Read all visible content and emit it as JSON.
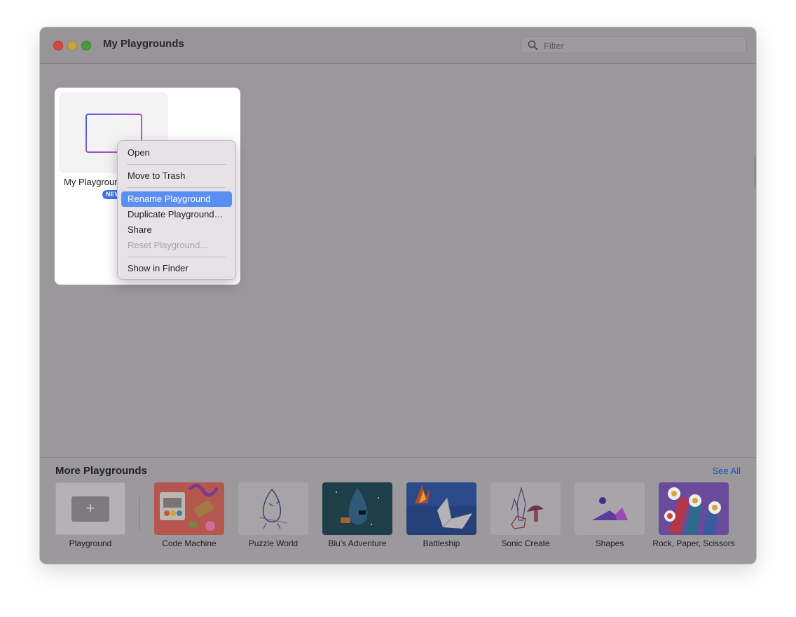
{
  "window": {
    "title": "My Playgrounds"
  },
  "filter": {
    "placeholder": "Filter"
  },
  "playground_tile": {
    "name": "My Playground",
    "badge": "NEW"
  },
  "context_menu": {
    "items": [
      {
        "label": "Open"
      },
      {
        "label": "Move to Trash"
      },
      {
        "label": "Rename Playground",
        "highlighted": true
      },
      {
        "label": "Duplicate Playground…"
      },
      {
        "label": "Share"
      },
      {
        "label": "Reset Playground…",
        "disabled": true
      },
      {
        "label": "Show in Finder"
      }
    ]
  },
  "more_playgrounds": {
    "title": "More Playgrounds",
    "see_all": "See All",
    "cards": [
      {
        "label": "Playground",
        "icon": "plus-icon"
      },
      {
        "label": "Code Machine"
      },
      {
        "label": "Puzzle World"
      },
      {
        "label": "Blu's Adventure"
      },
      {
        "label": "Battleship"
      },
      {
        "label": "Sonic Create"
      },
      {
        "label": "Shapes"
      },
      {
        "label": "Rock, Paper, Scissors"
      }
    ]
  },
  "colors": {
    "accent": "#5a8ef2",
    "link": "#1c4fc2",
    "badge": "#3f72e8"
  }
}
